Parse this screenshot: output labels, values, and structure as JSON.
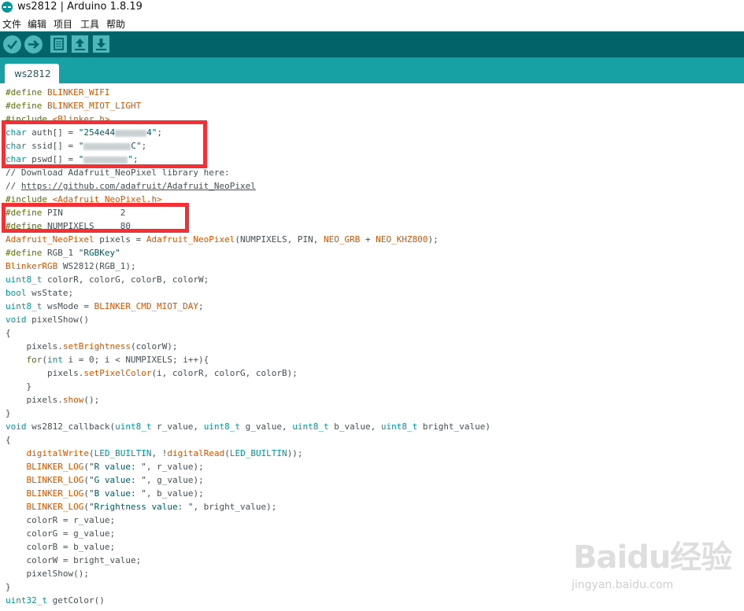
{
  "window": {
    "title": "ws2812 | Arduino 1.8.19"
  },
  "menu": [
    "文件",
    "编辑",
    "项目",
    "工具",
    "帮助"
  ],
  "toolbar": {
    "buttons": [
      "verify-icon",
      "upload-icon",
      "new-icon",
      "open-icon",
      "save-icon"
    ]
  },
  "tabs": [
    {
      "label": "ws2812"
    }
  ],
  "editor": {
    "lines": [
      [
        {
          "t": "#define ",
          "c": "pre"
        },
        {
          "t": "BLINKER_WIFI",
          "c": "fn"
        }
      ],
      [
        {
          "t": "#define ",
          "c": "pre"
        },
        {
          "t": "BLINKER_MIOT_LIGHT",
          "c": "fn"
        }
      ],
      [
        {
          "t": "#include ",
          "c": "pre"
        },
        {
          "t": "<Blinker.h>",
          "c": "fn"
        }
      ],
      [
        {
          "t": "char",
          "c": "type"
        },
        {
          "t": " auth[] = "
        },
        {
          "t": "\"254e44",
          "c": "str"
        },
        {
          "t": "r",
          "c": "redact"
        },
        {
          "t": "4\"",
          "c": "str"
        },
        {
          "t": ";"
        }
      ],
      [
        {
          "t": "char",
          "c": "type"
        },
        {
          "t": " ssid[] = "
        },
        {
          "t": "\"",
          "c": "str"
        },
        {
          "t": "r",
          "c": "redact"
        },
        {
          "t": "C\"",
          "c": "str"
        },
        {
          "t": ";"
        }
      ],
      [
        {
          "t": "char",
          "c": "type"
        },
        {
          "t": " pswd[] = "
        },
        {
          "t": "\"",
          "c": "str"
        },
        {
          "t": "r",
          "c": "redact"
        },
        {
          "t": "\"",
          "c": "str"
        },
        {
          "t": ";"
        }
      ],
      [
        {
          "t": "// Download Adafruit_NeoPixel library here:"
        }
      ],
      [
        {
          "t": "// "
        },
        {
          "t": "https://github.com/adafruit/Adafruit_NeoPixel",
          "c": "link"
        }
      ],
      [
        {
          "t": "#include ",
          "c": "pre"
        },
        {
          "t": "<Adafruit_NeoPixel.h>",
          "c": "fn"
        }
      ],
      [
        {
          "t": "#define ",
          "c": "pre"
        },
        {
          "t": "PIN           2"
        }
      ],
      [
        {
          "t": "#define ",
          "c": "pre"
        },
        {
          "t": "NUMPIXELS     80"
        }
      ],
      [
        {
          "t": "Adafruit_NeoPixel",
          "c": "fn"
        },
        {
          "t": " pixels = "
        },
        {
          "t": "Adafruit_NeoPixel",
          "c": "fn"
        },
        {
          "t": "(NUMPIXELS, PIN, "
        },
        {
          "t": "NEO_GRB",
          "c": "fn"
        },
        {
          "t": " + "
        },
        {
          "t": "NEO_KHZ800",
          "c": "fn"
        },
        {
          "t": ");"
        }
      ],
      [
        {
          "t": "#define ",
          "c": "pre"
        },
        {
          "t": "RGB_1 "
        },
        {
          "t": "\"RGBKey\"",
          "c": "str"
        }
      ],
      [
        {
          "t": "BlinkerRGB",
          "c": "fn"
        },
        {
          "t": " WS2812(RGB_1);"
        }
      ],
      [
        {
          "t": "uint8_t",
          "c": "type"
        },
        {
          "t": " colorR, colorG, colorB, colorW;"
        }
      ],
      [
        {
          "t": "bool",
          "c": "type"
        },
        {
          "t": " wsState;"
        }
      ],
      [
        {
          "t": "uint8_t",
          "c": "type"
        },
        {
          "t": " wsMode = "
        },
        {
          "t": "BLINKER_CMD_MIOT_DAY",
          "c": "fn"
        },
        {
          "t": ";"
        }
      ],
      [
        {
          "t": "void",
          "c": "type"
        },
        {
          "t": " pixelShow()"
        }
      ],
      [
        {
          "t": "{"
        }
      ],
      [
        {
          "t": "    pixels."
        },
        {
          "t": "setBrightness",
          "c": "fn"
        },
        {
          "t": "(colorW);"
        }
      ],
      [
        {
          "t": "    "
        },
        {
          "t": "for",
          "c": "pre"
        },
        {
          "t": "("
        },
        {
          "t": "int",
          "c": "type"
        },
        {
          "t": " i = 0; i < NUMPIXELS; i++){"
        }
      ],
      [
        {
          "t": "        pixels."
        },
        {
          "t": "setPixelColor",
          "c": "fn"
        },
        {
          "t": "(i, colorR, colorG, colorB);"
        }
      ],
      [
        {
          "t": "    }"
        }
      ],
      [
        {
          "t": "    pixels."
        },
        {
          "t": "show",
          "c": "fn"
        },
        {
          "t": "();"
        }
      ],
      [
        {
          "t": "}"
        }
      ],
      [
        {
          "t": "void",
          "c": "type"
        },
        {
          "t": " ws2812_callback("
        },
        {
          "t": "uint8_t",
          "c": "type"
        },
        {
          "t": " r_value, "
        },
        {
          "t": "uint8_t",
          "c": "type"
        },
        {
          "t": " g_value, "
        },
        {
          "t": "uint8_t",
          "c": "type"
        },
        {
          "t": " b_value, "
        },
        {
          "t": "uint8_t",
          "c": "type"
        },
        {
          "t": " bright_value)"
        }
      ],
      [
        {
          "t": "{"
        }
      ],
      [
        {
          "t": "    "
        },
        {
          "t": "digitalWrite",
          "c": "fn"
        },
        {
          "t": "("
        },
        {
          "t": "LED_BUILTIN",
          "c": "type"
        },
        {
          "t": ", !"
        },
        {
          "t": "digitalRead",
          "c": "fn"
        },
        {
          "t": "("
        },
        {
          "t": "LED_BUILTIN",
          "c": "type"
        },
        {
          "t": "));"
        }
      ],
      [
        {
          "t": "    "
        },
        {
          "t": "BLINKER_LOG",
          "c": "fn"
        },
        {
          "t": "("
        },
        {
          "t": "\"R value: \"",
          "c": "str"
        },
        {
          "t": ", r_value);"
        }
      ],
      [
        {
          "t": "    "
        },
        {
          "t": "BLINKER_LOG",
          "c": "fn"
        },
        {
          "t": "("
        },
        {
          "t": "\"G value: \"",
          "c": "str"
        },
        {
          "t": ", g_value);"
        }
      ],
      [
        {
          "t": "    "
        },
        {
          "t": "BLINKER_LOG",
          "c": "fn"
        },
        {
          "t": "("
        },
        {
          "t": "\"B value: \"",
          "c": "str"
        },
        {
          "t": ", b_value);"
        }
      ],
      [
        {
          "t": "    "
        },
        {
          "t": "BLINKER_LOG",
          "c": "fn"
        },
        {
          "t": "("
        },
        {
          "t": "\"Rrightness value: \"",
          "c": "str"
        },
        {
          "t": ", bright_value);"
        }
      ],
      [
        {
          "t": "    colorR = r_value;"
        }
      ],
      [
        {
          "t": "    colorG = g_value;"
        }
      ],
      [
        {
          "t": "    colorB = b_value;"
        }
      ],
      [
        {
          "t": "    colorW = bright_value;"
        }
      ],
      [
        {
          "t": "    pixelShow();"
        }
      ],
      [
        {
          "t": "}"
        }
      ],
      [
        {
          "t": "uint32_t",
          "c": "type"
        },
        {
          "t": " getColor()"
        }
      ]
    ]
  },
  "watermark": {
    "main": "Baidu经验",
    "sub": "jingyan.baidu.com"
  },
  "colors": {
    "toolbar": "#006468",
    "tabbar": "#17a1a5",
    "button": "#4db7bb",
    "highlight": "#f03237"
  }
}
